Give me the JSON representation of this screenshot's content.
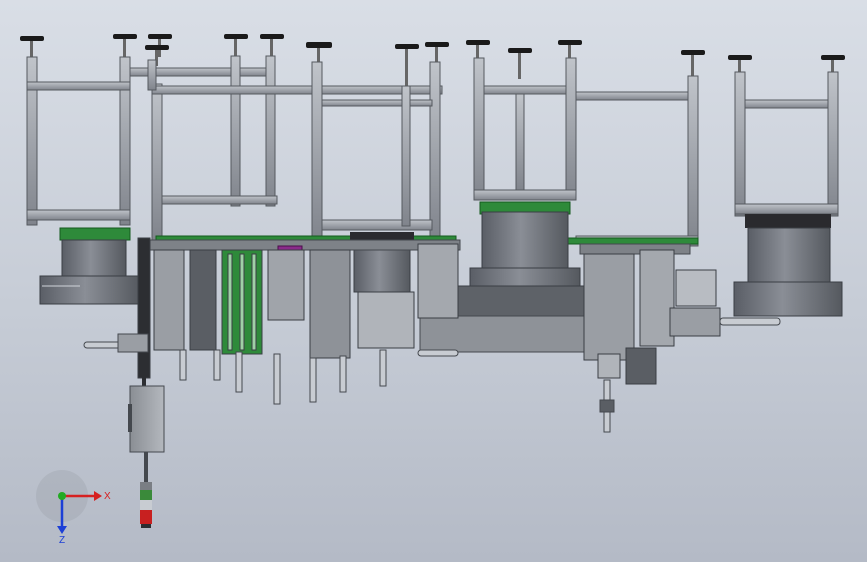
{
  "viewport": {
    "background_top": "#d9dee6",
    "background_bottom": "#b4bac6"
  },
  "triad": {
    "x_label": "X",
    "z_label": "Z",
    "x_color": "#d62020",
    "z_color": "#1c3fd6",
    "origin_color": "#22aa22"
  },
  "colors": {
    "frame": "#9aa0a8",
    "frame_dark": "#5c6068",
    "green": "#2e8a3a",
    "purple": "#8a2a8a",
    "drum": "#6c7078",
    "foot": "#1a1a1a"
  }
}
